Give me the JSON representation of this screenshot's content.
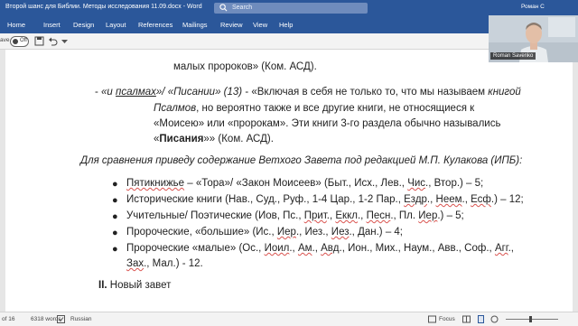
{
  "window": {
    "title": "Второй шанс для Библии. Методы исследования 11.09.docx  -  Word",
    "search_placeholder": "Search",
    "user_name": "Роман С"
  },
  "ribbon_tabs": [
    "Home",
    "Insert",
    "Design",
    "Layout",
    "References",
    "Mailings",
    "Review",
    "View",
    "Help"
  ],
  "toolbar": {
    "autosave_label": "ave",
    "autosave_state": "Off"
  },
  "document": {
    "l1": "малых пророков» (Ком. АСД).",
    "l2_a": "- ",
    "l2_b": "«и ",
    "l2_c": "псалмах",
    "l2_d": "»/ «Писании» (13)",
    "l2_e": " - «Включая в себя не только то, что мы называем ",
    "l2_f": "книгой",
    "l3_a": "Псалмов",
    "l3_b": ", но вероятно также и все другие книги, не относящиеся к",
    "l4": "«Моисею» или «пророкам». Эти книги 3-го раздела обычно назывались",
    "l5_a": "«",
    "l5_b": "Писания",
    "l5_c": "»» (Ком. АСД).",
    "l6": "Для сравнения приведу содержание Ветхого Завета под редакцией М.П. Кулакова (ИПБ):",
    "b1_a": "Пятикнижье",
    "b1_b": " – «Тора»/ «Закон Моисеев» (Быт., Исх., Лев., ",
    "b1_c": "Чис",
    "b1_d": "., Втор.) – 5;",
    "b2_a": "Исторические книги (Нав., Суд., Руф., 1-4 Цар., 1-2 Пар., ",
    "b2_b": "Ездр",
    "b2_c": "., ",
    "b2_d": "Неем",
    "b2_e": "., ",
    "b2_f": "Есф",
    "b2_g": ".) – 12;",
    "b3_a": "Учительные/ Поэтические (Иов, Пс., ",
    "b3_b": "Прит",
    "b3_c": "., ",
    "b3_d": "Еккл",
    "b3_e": "., ",
    "b3_f": "Песн",
    "b3_g": "., Пл. ",
    "b3_h": "Иер",
    "b3_i": ".) – 5;",
    "b4_a": "Пророческие, «большие» (Ис., ",
    "b4_b": "Иер",
    "b4_c": "., Иез., ",
    "b4_d": "Иез",
    "b4_e": "., Дан.) – 4;",
    "b5_a": "Пророческие «малые» (Ос., ",
    "b5_b": "Иоил",
    "b5_c": "., ",
    "b5_d": "Ам",
    "b5_e": "., ",
    "b5_f": "Авд",
    "b5_g": "., Ион., Мих., Наум., Авв., Соф., ",
    "b5_h": "Агг",
    "b5_i": ".,",
    "b6_a": "Зах",
    "b6_b": "., Мал.) - 12.",
    "h2_a": "II.",
    "h2_b": " Новый завет",
    "bullet_char": "●"
  },
  "status": {
    "page": "of 16",
    "words": "6318 words",
    "language": "Russian",
    "focus": "Focus"
  },
  "video": {
    "name": "Roman Savenko"
  },
  "colors": {
    "accent": "#2b579a",
    "squiggle": "#d9534f"
  }
}
